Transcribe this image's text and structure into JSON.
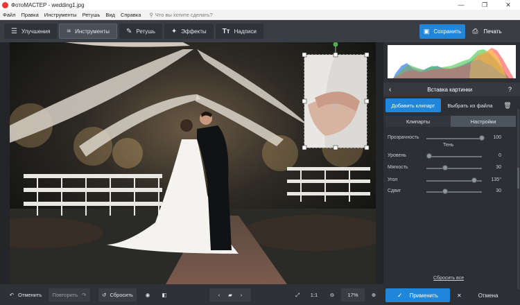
{
  "window": {
    "title": "ФотоМАСТЕР - wedding1.jpg",
    "min": "—",
    "max": "❐",
    "close": "✕"
  },
  "menu": {
    "items": [
      "Файл",
      "Правка",
      "Инструменты",
      "Ретушь",
      "Вид",
      "Справка"
    ],
    "search_placeholder": "Что вы хотите сделать?"
  },
  "toolbar": {
    "tabs": [
      {
        "label": "Улучшения",
        "icon": "sliders-icon"
      },
      {
        "label": "Инструменты",
        "icon": "crop-icon"
      },
      {
        "label": "Ретушь",
        "icon": "brush-icon"
      },
      {
        "label": "Эффекты",
        "icon": "magic-wand-icon"
      },
      {
        "label": "Надписи",
        "icon": "text-icon"
      }
    ],
    "save": "Сохранить",
    "print": "Печать"
  },
  "bottom": {
    "undo": "Отменить",
    "redo": "Повторить",
    "reset": "Сбросить",
    "ratio": "1:1",
    "zoom": "17%"
  },
  "panel": {
    "title": "Вставка картинки",
    "help": "?",
    "add_clipart": "Добавить клипарт",
    "from_file": "Выбрать из файла",
    "subtabs": [
      "Клипарты",
      "Настройки"
    ],
    "opacity": {
      "label": "Прозрачность",
      "value": "100",
      "level": 1.0
    },
    "shadow_section": "Тень",
    "shadow": [
      {
        "label": "Уровень",
        "value": "0",
        "level": 0.0
      },
      {
        "label": "Мягкость",
        "value": "30",
        "level": 0.3
      },
      {
        "label": "Угол",
        "value": "135°",
        "level": 0.85
      },
      {
        "label": "Сдвиг",
        "value": "30",
        "level": 0.3
      }
    ],
    "reset_all": "Сбросить все",
    "apply": "Применить",
    "cancel": "Отмена"
  },
  "colors": {
    "accent": "#1f86d9",
    "bg": "#2b2e33",
    "panel": "#2c2f34"
  }
}
